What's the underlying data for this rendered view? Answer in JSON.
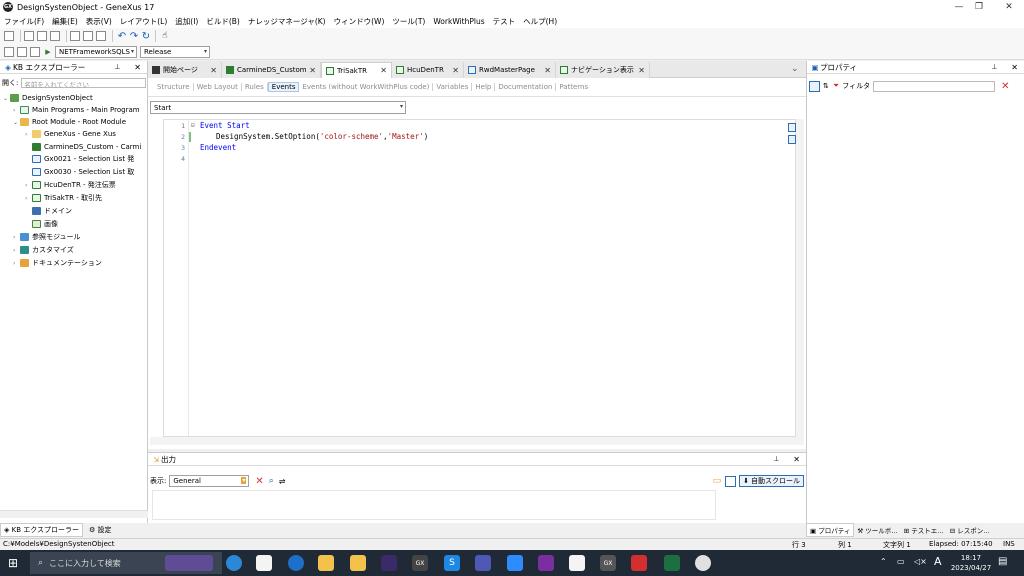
{
  "window": {
    "title": "DesignSystenObject - GeneXus 17"
  },
  "menu": [
    "ファイル(F)",
    "編集(E)",
    "表示(V)",
    "レイアウト(L)",
    "追加(I)",
    "ビルド(B)",
    "ナレッジマネージャ(K)",
    "ウィンドウ(W)",
    "ツール(T)",
    "WorkWithPlus",
    "テスト",
    "ヘルプ(H)"
  ],
  "toolbar": {
    "platform": "NETFrameworkSQLS",
    "config": "Release"
  },
  "kb_explorer": {
    "title": "KB エクスプローラー",
    "open_label": "開く:",
    "search_placeholder": "名前を入れてください",
    "root": "DesignSystenObject",
    "items": [
      "Main Programs - Main Program",
      "Root Module - Root Module",
      "GeneXus - Gene Xus",
      "CarmineDS_Custom - Carmi",
      "Gx0021 - Selection List 発",
      "Gx0030 - Selection List 取",
      "HcuDenTR - 発注伝票",
      "TriSakTR - 取引先",
      "ドメイン",
      "画像",
      "参照モジュール",
      "カスタマイズ",
      "ドキュメンテーション"
    ],
    "bottom_tabs": [
      "KB エクスプローラー",
      "設定"
    ]
  },
  "tabs": [
    "開始ページ",
    "CarmineDS_Custom",
    "TriSakTR",
    "HcuDenTR",
    "RwdMasterPage",
    "ナビゲーション表示"
  ],
  "subtabs": [
    "Structure",
    "Web Layout",
    "Rules",
    "Events",
    "Events (without WorkWithPlus code)",
    "Variables",
    "Help",
    "Documentation",
    "Patterns"
  ],
  "event_selector": "Start",
  "code": {
    "line_numbers": [
      "1",
      "2",
      "3",
      "4"
    ],
    "line1_kw": "Event Start",
    "line2_a": "DesignSystem.SetOption(",
    "line2_s1": "'color-scheme'",
    "line2_c": ",",
    "line2_s2": "'Master'",
    "line2_e": ")",
    "line3": "Endevent"
  },
  "output": {
    "title": "出力",
    "show_label": "表示:",
    "source": "General",
    "autoscroll": "自動スクロール"
  },
  "properties": {
    "title": "プロパティ",
    "filter_label": "フィルタ",
    "bottom_tabs": [
      "プロパティ",
      "ツールボ…",
      "テストエ…",
      "レスポン…"
    ]
  },
  "status": {
    "path": "C:¥Models¥DesignSystenObject",
    "row": "行 3",
    "col": "列 1",
    "chars": "文字列 1",
    "elapsed": "Elapsed: 07:15:40",
    "mode": "INS"
  },
  "taskbar": {
    "search_placeholder": "ここに入力して検索",
    "time": "18:17",
    "date": "2023/04/27",
    "ime": "A"
  }
}
